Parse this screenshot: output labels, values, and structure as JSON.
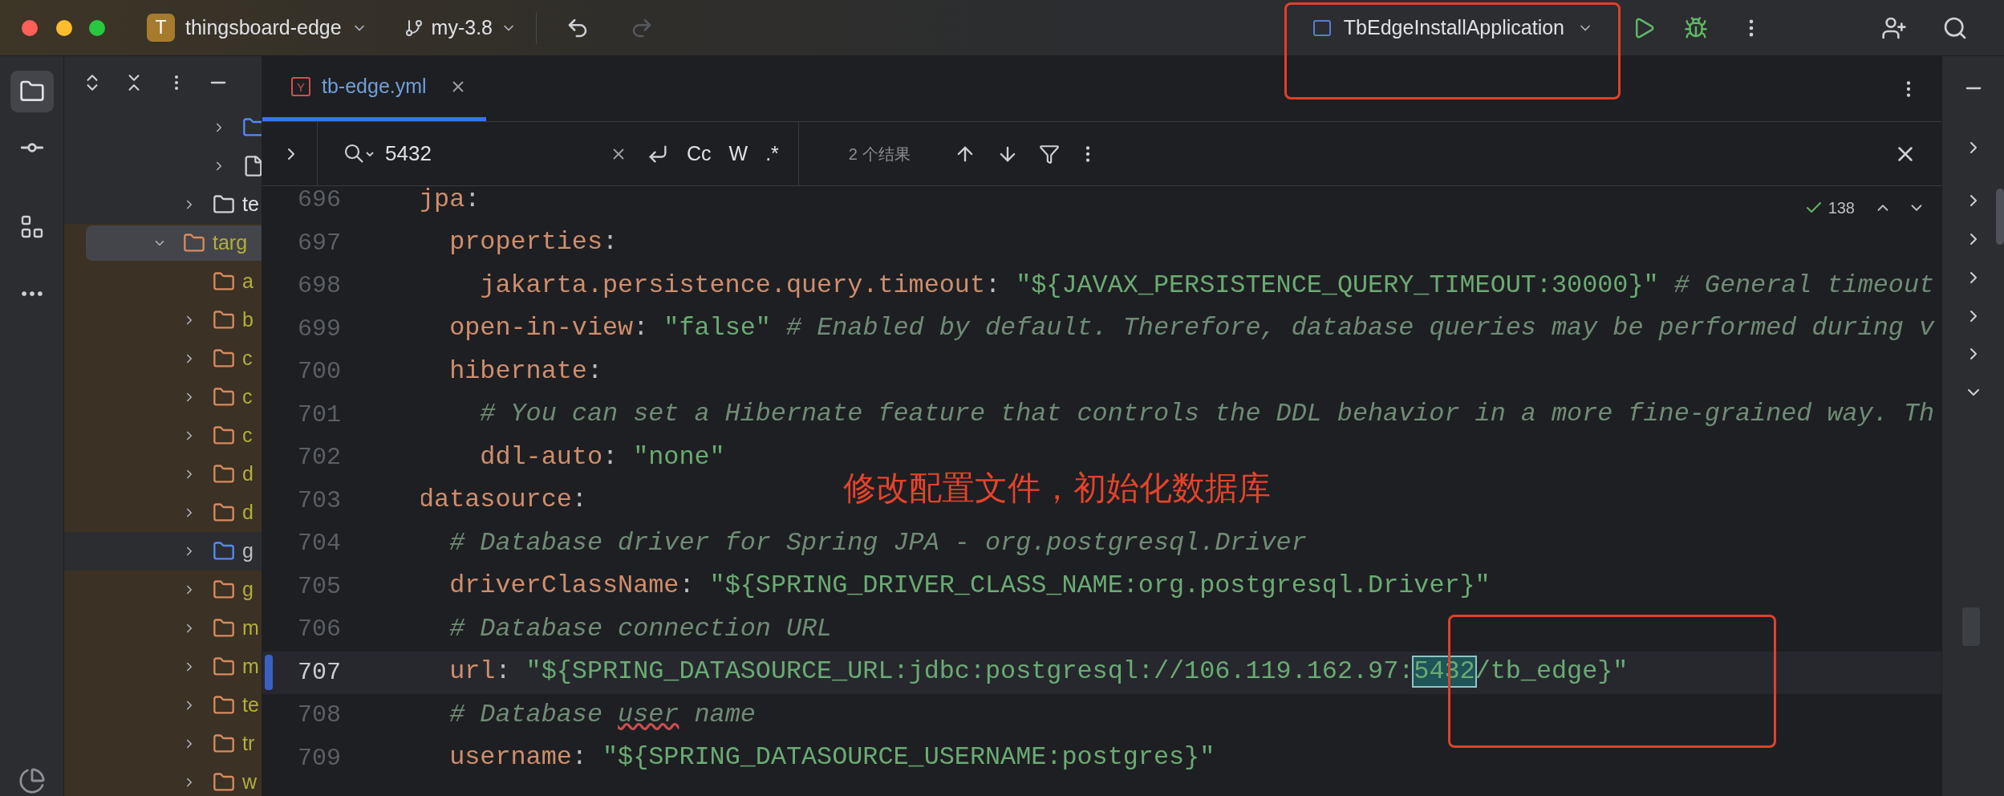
{
  "title_bar": {
    "project_badge": "T",
    "project": "thingsboard-edge",
    "branch": "my-3.8",
    "redo_disabled": true,
    "run_config": "TbEdgeInstallApplication"
  },
  "project_tree": [
    {
      "children": [
        {
          "children": [
            {
              "kind": "source_folder",
              "expanded": false,
              "leaf": false,
              "selected": false
            },
            {
              "kind": "file",
              "expanded": false,
              "leaf": false,
              "selected": false
            }
          ]
        },
        {
          "label": "te",
          "kind": "folder",
          "expanded": false,
          "leaf": false,
          "selected": false
        }
      ]
    },
    {
      "label": "targ",
      "kind": "excluded_folder",
      "expanded": true,
      "leaf": false,
      "selected": true,
      "children": [
        {
          "label": "a",
          "kind": "excluded_folder",
          "leaf": true,
          "selected": false
        },
        {
          "label": "b",
          "kind": "excluded_folder",
          "expanded": false,
          "leaf": false,
          "selected": false
        },
        {
          "label": "c",
          "kind": "excluded_folder",
          "expanded": false,
          "leaf": false,
          "selected": false
        },
        {
          "label": "c",
          "kind": "excluded_folder",
          "expanded": false,
          "leaf": false,
          "selected": false
        },
        {
          "label": "c",
          "kind": "excluded_folder",
          "expanded": false,
          "leaf": false,
          "selected": false
        },
        {
          "label": "d",
          "kind": "excluded_folder",
          "expanded": false,
          "leaf": false,
          "selected": false
        },
        {
          "label": "d",
          "kind": "excluded_folder",
          "expanded": false,
          "leaf": false,
          "selected": false
        },
        {
          "label": "g",
          "kind": "source_folder",
          "expanded": false,
          "leaf": false,
          "selected": false
        },
        {
          "label": "g",
          "kind": "excluded_folder",
          "expanded": false,
          "leaf": false,
          "selected": false
        },
        {
          "label": "m",
          "kind": "excluded_folder",
          "expanded": false,
          "leaf": false,
          "selected": false
        },
        {
          "label": "m",
          "kind": "excluded_folder",
          "expanded": false,
          "leaf": false,
          "selected": false
        },
        {
          "label": "te",
          "kind": "excluded_folder",
          "expanded": false,
          "leaf": false,
          "selected": false
        },
        {
          "label": "tr",
          "kind": "excluded_folder",
          "expanded": false,
          "leaf": false,
          "selected": false
        },
        {
          "label": "w",
          "kind": "excluded_folder",
          "expanded": false,
          "leaf": false,
          "selected": false
        }
      ]
    }
  ],
  "tabs": [
    {
      "label": "tb-edge.yml",
      "icon_letter": "Y",
      "selected": true
    }
  ],
  "search": {
    "query": "5432",
    "options": [
      "Cc",
      "W",
      ".*"
    ],
    "result_count": "2 个结果"
  },
  "inspection": {
    "count": "138"
  },
  "lines": [
    {
      "number": "696",
      "current": false,
      "changed": false,
      "tokens": [
        {
          "kind": "key",
          "text": "jpa"
        },
        {
          "kind": "punct",
          "text": ":"
        }
      ]
    },
    {
      "number": "697",
      "current": false,
      "changed": false,
      "tokens": [
        {
          "kind": "key",
          "text": "  properties"
        },
        {
          "kind": "punct",
          "text": ":"
        }
      ]
    },
    {
      "number": "698",
      "current": false,
      "changed": false,
      "tokens": [
        {
          "kind": "key",
          "text": "    jakarta.persistence.query.timeout"
        },
        {
          "kind": "punct",
          "text": ": "
        },
        {
          "kind": "string",
          "text": "\"${JAVAX_PERSISTENCE_QUERY_TIMEOUT:30000}\""
        },
        {
          "kind": "comment",
          "text": " # General timeout"
        }
      ]
    },
    {
      "number": "699",
      "current": false,
      "changed": false,
      "tokens": [
        {
          "kind": "key",
          "text": "  open-in-view"
        },
        {
          "kind": "punct",
          "text": ": "
        },
        {
          "kind": "string",
          "text": "\"false\""
        },
        {
          "kind": "comment",
          "text": " # Enabled by default. Therefore, database queries may be performed during v"
        }
      ]
    },
    {
      "number": "700",
      "current": false,
      "changed": false,
      "tokens": [
        {
          "kind": "key",
          "text": "  hibernate"
        },
        {
          "kind": "punct",
          "text": ":"
        }
      ]
    },
    {
      "number": "701",
      "current": false,
      "changed": false,
      "tokens": [
        {
          "kind": "comment",
          "text": "    # You can set a Hibernate feature that controls the DDL behavior in a more fine-grained way. Th"
        }
      ]
    },
    {
      "number": "702",
      "current": false,
      "changed": false,
      "tokens": [
        {
          "kind": "key",
          "text": "    ddl-auto"
        },
        {
          "kind": "punct",
          "text": ": "
        },
        {
          "kind": "string",
          "text": "\"none\""
        }
      ]
    },
    {
      "number": "703",
      "current": false,
      "changed": false,
      "tokens": [
        {
          "kind": "key",
          "text": "datasource"
        },
        {
          "kind": "punct",
          "text": ":"
        }
      ]
    },
    {
      "number": "704",
      "current": false,
      "changed": false,
      "tokens": [
        {
          "kind": "comment",
          "text": "  # Database driver for Spring JPA - org.postgresql.Driver"
        }
      ]
    },
    {
      "number": "705",
      "current": false,
      "changed": false,
      "tokens": [
        {
          "kind": "key",
          "text": "  driverClassName"
        },
        {
          "kind": "punct",
          "text": ": "
        },
        {
          "kind": "string",
          "text": "\"${SPRING_DRIVER_CLASS_NAME:org.postgresql.Driver}\""
        }
      ]
    },
    {
      "number": "706",
      "current": false,
      "changed": false,
      "tokens": [
        {
          "kind": "comment",
          "text": "  # Database connection URL"
        }
      ]
    },
    {
      "number": "707",
      "current": true,
      "changed": true,
      "tokens": [
        {
          "kind": "key",
          "text": "  url"
        },
        {
          "kind": "punct",
          "text": ": "
        },
        {
          "kind": "string",
          "text": "\"${SPRING_DATASOURCE_URL:jdbc:postgresql://106.119.162.97:"
        },
        {
          "kind": "match",
          "text": "5432"
        },
        {
          "kind": "string",
          "text": "/tb_edge}\""
        }
      ]
    },
    {
      "number": "708",
      "current": false,
      "changed": false,
      "tokens": [
        {
          "kind": "comment",
          "text": "  # Database "
        },
        {
          "kind": "typo",
          "text": "user"
        },
        {
          "kind": "comment",
          "text": " name"
        }
      ]
    },
    {
      "number": "709",
      "current": false,
      "changed": false,
      "tokens": [
        {
          "kind": "key",
          "text": "  username"
        },
        {
          "kind": "punct",
          "text": ": "
        },
        {
          "kind": "string",
          "text": "\"${SPRING_DATASOURCE_USERNAME:postgres}\""
        }
      ]
    }
  ],
  "annotation": {
    "text": "修改配置文件，初始化数据库"
  }
}
